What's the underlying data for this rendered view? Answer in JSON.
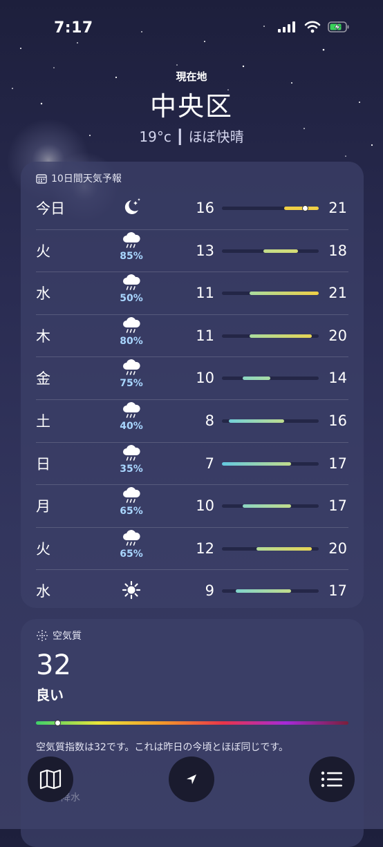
{
  "status": {
    "time": "7:17"
  },
  "header": {
    "location_label": "現在地",
    "city": "中央区",
    "condition": "19°c ┃ ほぼ快晴"
  },
  "forecast": {
    "title": "10日間天気予報",
    "scale": {
      "min": 7,
      "max": 21
    },
    "current_temp": 19,
    "days": [
      {
        "day": "今日",
        "icon": "moon-stars-icon",
        "precip": "",
        "low": "16",
        "high": "21",
        "lo": 16,
        "hi": 21,
        "colors": [
          "#f0cf45",
          "#f0cf45"
        ],
        "current": true
      },
      {
        "day": "火",
        "icon": "cloud-rain-icon",
        "precip": "85%",
        "low": "13",
        "high": "18",
        "lo": 13,
        "hi": 18,
        "colors": [
          "#c2dc8b",
          "#d6dc74"
        ]
      },
      {
        "day": "水",
        "icon": "cloud-rain-icon",
        "precip": "50%",
        "low": "11",
        "high": "21",
        "lo": 11,
        "hi": 21,
        "colors": [
          "#a9dc9f",
          "#f0cf45"
        ]
      },
      {
        "day": "木",
        "icon": "cloud-rain-icon",
        "precip": "80%",
        "low": "11",
        "high": "20",
        "lo": 11,
        "hi": 20,
        "colors": [
          "#a9dc9f",
          "#e6d454"
        ]
      },
      {
        "day": "金",
        "icon": "cloud-rain-icon",
        "precip": "75%",
        "low": "10",
        "high": "14",
        "lo": 10,
        "hi": 14,
        "colors": [
          "#8bd6c3",
          "#a8dca3"
        ]
      },
      {
        "day": "土",
        "icon": "cloud-rain-icon",
        "precip": "40%",
        "low": "8",
        "high": "16",
        "lo": 8,
        "hi": 16,
        "colors": [
          "#72d0d8",
          "#bedc8f"
        ]
      },
      {
        "day": "日",
        "icon": "cloud-rain-icon",
        "precip": "35%",
        "low": "7",
        "high": "17",
        "lo": 7,
        "hi": 17,
        "colors": [
          "#63c8e0",
          "#c2dc8b"
        ]
      },
      {
        "day": "月",
        "icon": "cloud-rain-icon",
        "precip": "65%",
        "low": "10",
        "high": "17",
        "lo": 10,
        "hi": 17,
        "colors": [
          "#8bd6c3",
          "#c2dc8b"
        ]
      },
      {
        "day": "火",
        "icon": "cloud-rain-icon",
        "precip": "65%",
        "low": "12",
        "high": "20",
        "lo": 12,
        "hi": 20,
        "colors": [
          "#b3dc99",
          "#e6d454"
        ]
      },
      {
        "day": "水",
        "icon": "sun-icon",
        "precip": "",
        "low": "9",
        "high": "17",
        "lo": 9,
        "hi": 17,
        "colors": [
          "#7fd3cc",
          "#c2dc8b"
        ]
      }
    ]
  },
  "air_quality": {
    "title": "空気質",
    "value": "32",
    "category": "良い",
    "index_fraction": 0.07,
    "description": "空気質指数は32です。これは昨日の今頃とほぼ同じです。",
    "faded_next": "降水"
  },
  "toolbar": {
    "map": "map-icon",
    "location": "location-arrow-icon",
    "list": "list-icon"
  }
}
